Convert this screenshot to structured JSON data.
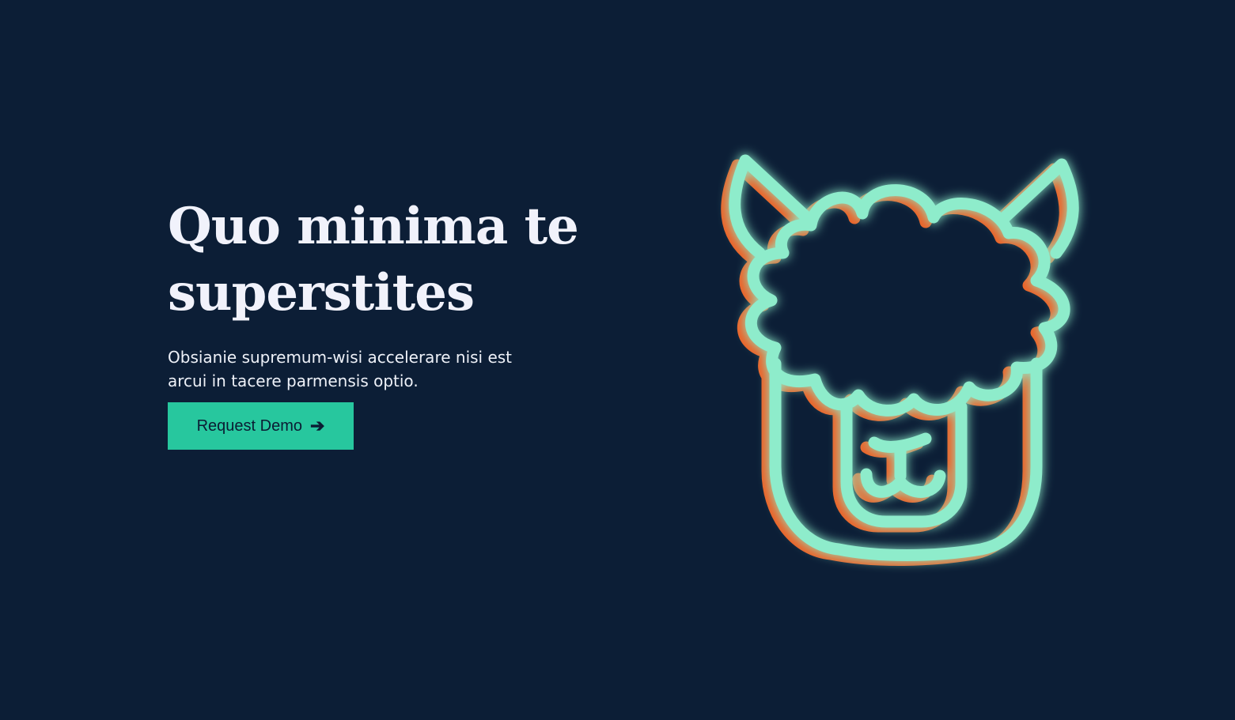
{
  "hero": {
    "headline_line1": "Quo minima te",
    "headline_line2": "superstites",
    "subtitle": "Obsianie supremum-wisi accelerare nisi est arcui in tacere parmensis optio.",
    "cta_label": "Request Demo",
    "cta_icon": "arrow-right-icon",
    "cta_arrow": "➔"
  },
  "illustration": {
    "icon": "llama-icon"
  },
  "colors": {
    "background": "#0c1e36",
    "accent_green": "#27c79e",
    "mint_stroke": "#8eeccb",
    "orange_shadow": "#ec6126",
    "headline": "#f1f2fb"
  }
}
